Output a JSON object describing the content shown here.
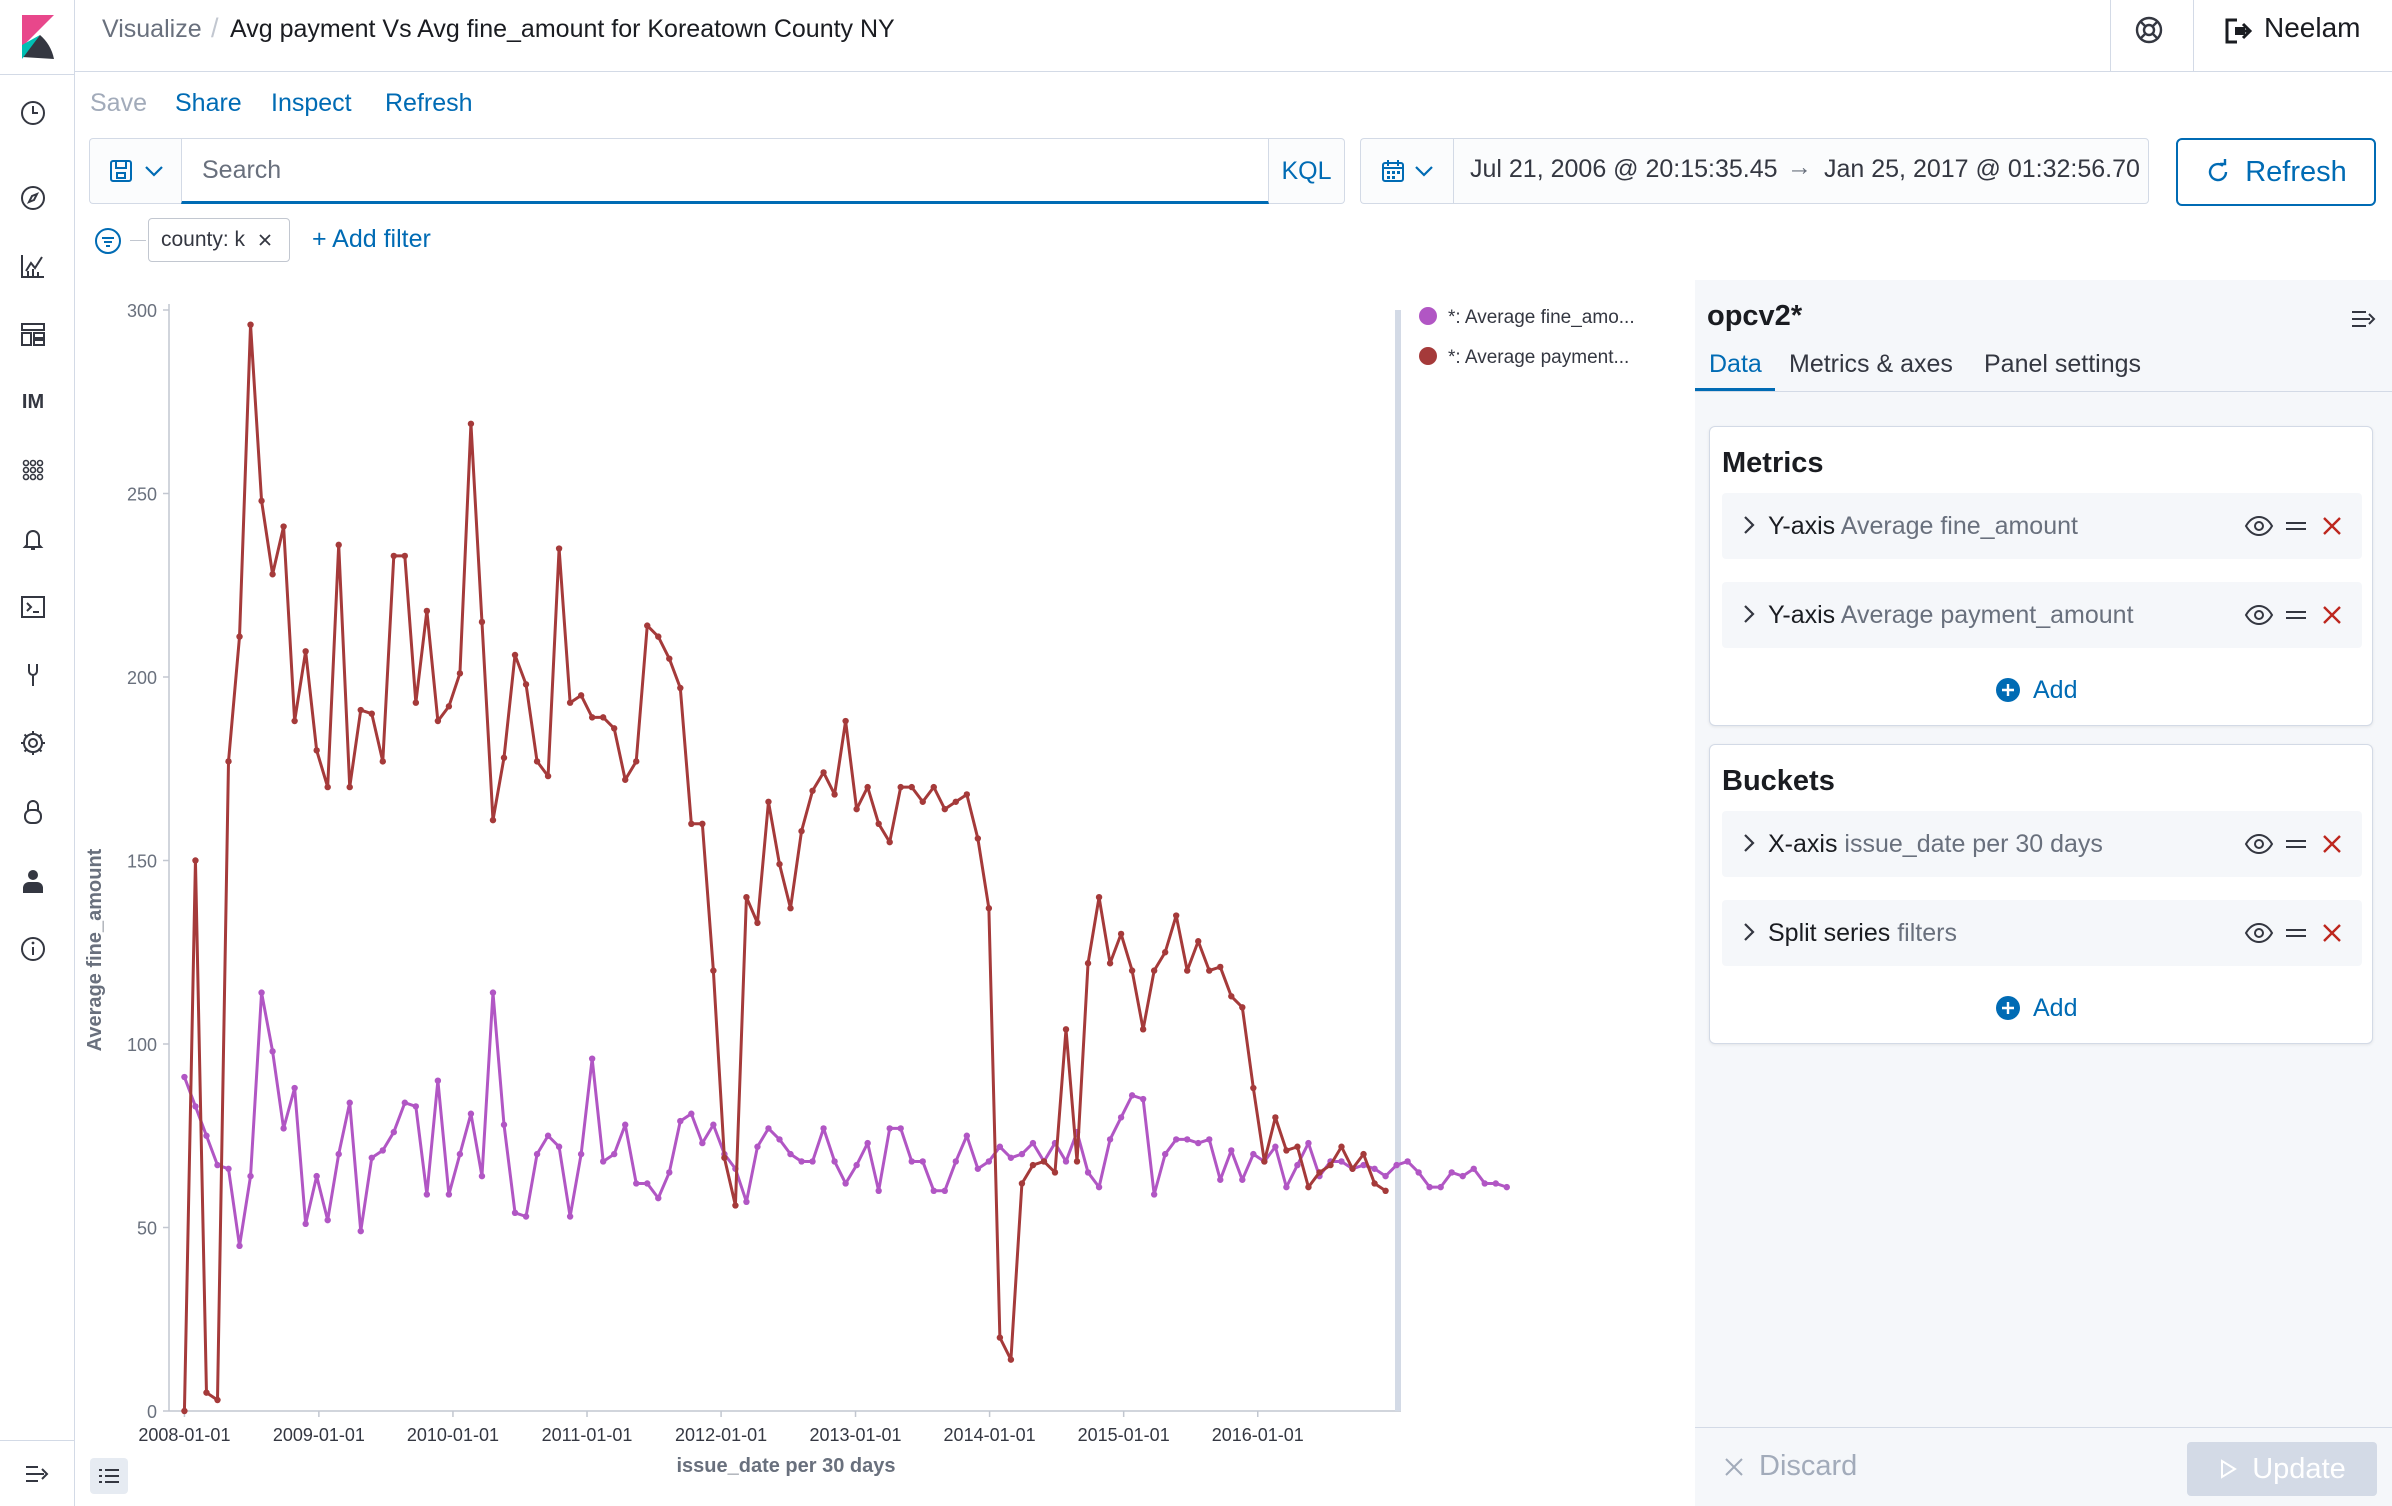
{
  "header": {
    "breadcrumb_root": "Visualize",
    "title": "Avg payment Vs Avg fine_amount for Koreatown County NY",
    "user_name": "Neelam"
  },
  "menu": {
    "save": "Save",
    "share": "Share",
    "inspect": "Inspect",
    "refresh": "Refresh"
  },
  "query": {
    "placeholder": "Search",
    "language": "KQL",
    "date_start": "Jul 21, 2006 @ 20:15:35.45",
    "date_arrow": "→",
    "date_end": "Jan 25, 2017 @ 01:32:56.70",
    "refresh_label": "Refresh"
  },
  "filters": {
    "pill": "county: k",
    "add_filter": "+ Add filter"
  },
  "sidebar": {
    "index_pattern": "opcv2*",
    "tabs": [
      "Data",
      "Metrics & axes",
      "Panel settings"
    ],
    "metrics_title": "Metrics",
    "metrics": [
      {
        "type": "Y-axis",
        "desc": "Average fine_amount"
      },
      {
        "type": "Y-axis",
        "desc": "Average payment_amount"
      }
    ],
    "buckets_title": "Buckets",
    "buckets": [
      {
        "type": "X-axis",
        "desc": "issue_date per 30 days"
      },
      {
        "type": "Split series",
        "desc": "filters"
      }
    ],
    "add_label": "Add",
    "discard_label": "Discard",
    "update_label": "Update"
  },
  "chart_data": {
    "type": "line",
    "xlabel": "issue_date per 30 days",
    "ylabel": "Average fine_amount",
    "ylim": [
      0,
      300
    ],
    "xlim": [
      "2007-11-20",
      "2017-01-25"
    ],
    "x_ticks": [
      "2008-01-01",
      "2009-01-01",
      "2010-01-01",
      "2011-01-01",
      "2012-01-01",
      "2013-01-01",
      "2014-01-01",
      "2015-01-01",
      "2016-01-01"
    ],
    "y_ticks": [
      0,
      50,
      100,
      150,
      200,
      250,
      300
    ],
    "legend_position": "right",
    "start_date": "2008-01-01",
    "interval_days": 30,
    "series": [
      {
        "name": "*: Average fine_amo...",
        "color": "#b156c4",
        "values": [
          91,
          83,
          75,
          67,
          66,
          45,
          64,
          114,
          98,
          77,
          88,
          51,
          64,
          52,
          70,
          84,
          49,
          69,
          71,
          76,
          84,
          83,
          59,
          90,
          59,
          70,
          81,
          64,
          114,
          78,
          54,
          53,
          70,
          75,
          72,
          53,
          70,
          96,
          68,
          70,
          78,
          62,
          62,
          58,
          65,
          79,
          81,
          73,
          78,
          70,
          66,
          57,
          72,
          77,
          74,
          70,
          68,
          68,
          77,
          68,
          62,
          67,
          73,
          60,
          77,
          77,
          68,
          68,
          60,
          60,
          68,
          75,
          66,
          68,
          72,
          69,
          70,
          73,
          68,
          73,
          68,
          76,
          65,
          61,
          74,
          80,
          86,
          85,
          59,
          70,
          74,
          74,
          73,
          74,
          63,
          71,
          63,
          70,
          68,
          72,
          61,
          67,
          73,
          64,
          68,
          68,
          66,
          67,
          66,
          64,
          67,
          68,
          65,
          61,
          61,
          65,
          64,
          66,
          62,
          62,
          61
        ]
      },
      {
        "name": "*: Average payment...",
        "color": "#a53a3a",
        "values": [
          0,
          150,
          5,
          3,
          177,
          211,
          296,
          248,
          228,
          241,
          188,
          207,
          180,
          170,
          236,
          170,
          191,
          190,
          177,
          233,
          233,
          193,
          218,
          188,
          192,
          201,
          269,
          215,
          161,
          178,
          206,
          198,
          177,
          173,
          235,
          193,
          195,
          189,
          189,
          186,
          172,
          177,
          214,
          211,
          205,
          197,
          160,
          160,
          120,
          69,
          56,
          140,
          133,
          166,
          149,
          137,
          158,
          169,
          174,
          168,
          188,
          164,
          170,
          160,
          155,
          170,
          170,
          166,
          170,
          164,
          166,
          168,
          156,
          137,
          20,
          14,
          62,
          67,
          68,
          65,
          104,
          68,
          122,
          140,
          122,
          130,
          120,
          104,
          120,
          125,
          135,
          120,
          128,
          120,
          121,
          113,
          110,
          88,
          68,
          80,
          71,
          72,
          61,
          65,
          67,
          72,
          66,
          70,
          62,
          60
        ]
      }
    ]
  }
}
